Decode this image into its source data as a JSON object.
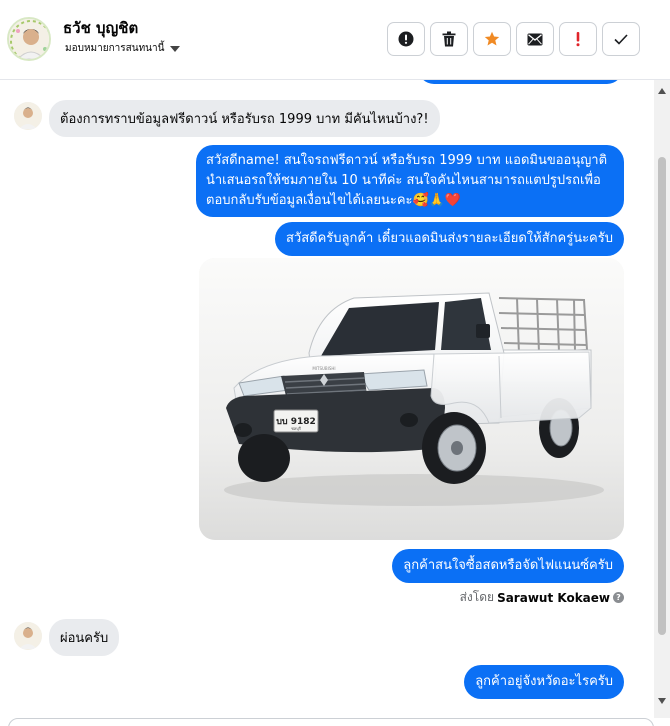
{
  "header": {
    "contact_name": "ธวัช บุญชิต",
    "assign_label": "มอบหมายการสนทนานี้"
  },
  "toolbar": {
    "items": [
      {
        "name": "alert-circle-icon"
      },
      {
        "name": "trash-icon"
      },
      {
        "name": "star-icon"
      },
      {
        "name": "envelope-icon"
      },
      {
        "name": "exclamation-icon"
      },
      {
        "name": "check-icon"
      }
    ]
  },
  "messages": {
    "incoming_1": "ต้องการทราบข้อมูลฟรีดาวน์ หรือรับรถ 1999 บาท มีคันไหนบ้าง?!",
    "outgoing_1_lines": [
      "สวัสดีname! สนใจรถฟรีดาวน์ หรือรับรถ 1999 บาท แอดมินขออนุญาติ",
      "นำเสนอรถให้ชมภายใน 10 นาทีค่ะ สนใจคันไหนสามารถแตปรูปรถเพื่อ",
      "ตอบกลับรับข้อมูลเงื่อนไขได้เลยนะคะ🥰🙏❤️"
    ],
    "outgoing_2": "สวัสดีครับลูกค้า เดี๋ยวแอดมินส่งรายละเอียดให้สักครู่นะครับ",
    "car_plate": "บบ 9182",
    "car_plate_province": "ชลบุรี",
    "car_brand": "MITSUBISHI",
    "outgoing_3": "ลูกค้าสนใจซื้อสดหรือจัดไฟแนนซ์ครับ",
    "sent_by_prefix": "ส่งโดย",
    "sent_by_name": "Sarawut Kokaew",
    "incoming_2": "ผ่อนครับ",
    "outgoing_4": "ลูกค้าอยู่จังหวัดอะไรครับ"
  },
  "colors": {
    "accent": "#0b70f5",
    "incoming_bubble": "#e9ebee",
    "star": "#f08a24",
    "exclamation": "#e0242a"
  }
}
